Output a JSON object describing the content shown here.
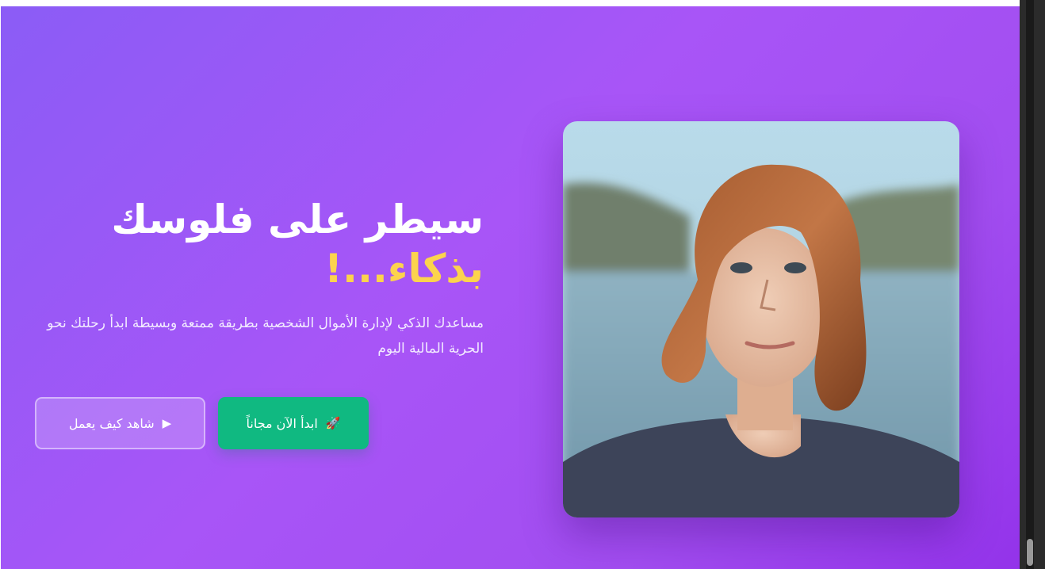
{
  "hero": {
    "headline_line1": "سيطر على فلوسك",
    "headline_line2": "بذكاء...!",
    "subtitle": "مساعدك الذكي لإدارة الأموال الشخصية بطريقة ممتعة وبسيطة ابدأ رحلتك نحو الحرية المالية اليوم",
    "primary_button": {
      "icon": "rocket-icon",
      "label": "ابدأ الآن مجاناً"
    },
    "secondary_button": {
      "icon": "play-icon",
      "label": "شاهد كيف يعمل"
    },
    "photo": {
      "subject": "portrait-photo"
    }
  },
  "colors": {
    "gradient_start": "#8b5cf6",
    "gradient_end": "#9333ea",
    "accent_yellow": "#fcd34d",
    "primary_green": "#10b981"
  }
}
